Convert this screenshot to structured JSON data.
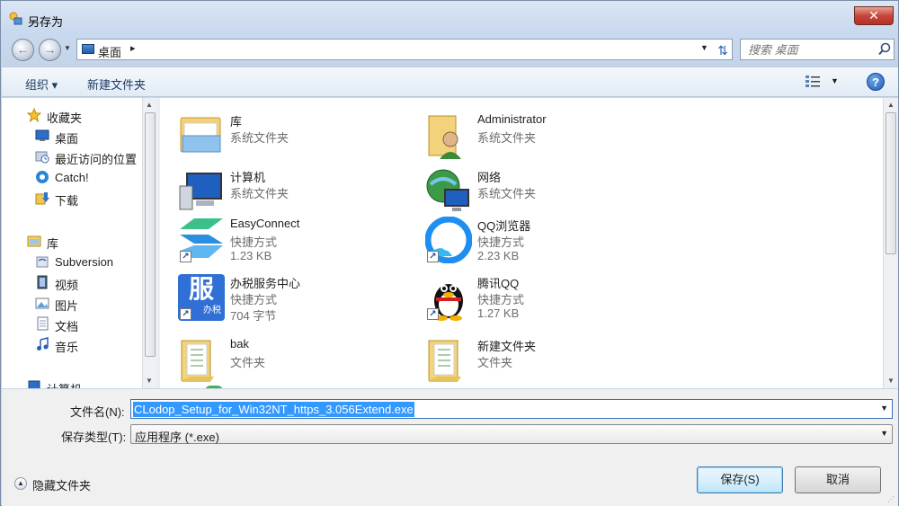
{
  "window": {
    "title": "另存为",
    "close_glyph": "✕"
  },
  "address": {
    "back_glyph": "←",
    "forward_glyph": "→",
    "path": "桌面",
    "separator": "▸",
    "refresh_glyph": "⇅",
    "search_placeholder": "搜索 桌面"
  },
  "toolbar": {
    "organize_label": "组织 ▾",
    "new_folder_label": "新建文件夹",
    "help_glyph": "?"
  },
  "nav": {
    "items": [
      {
        "label": "收藏夹",
        "icon": "star-icon"
      },
      {
        "label": "桌面",
        "icon": "desktop-icon"
      },
      {
        "label": "最近访问的位置",
        "icon": "recent-places-icon"
      },
      {
        "label": "Catch!",
        "icon": "catch-icon"
      },
      {
        "label": "下载",
        "icon": "downloads-icon"
      },
      {
        "label": "库",
        "icon": "library-icon"
      },
      {
        "label": "Subversion",
        "icon": "subversion-icon"
      },
      {
        "label": "视频",
        "icon": "videos-icon"
      },
      {
        "label": "图片",
        "icon": "pictures-icon"
      },
      {
        "label": "文档",
        "icon": "documents-icon"
      },
      {
        "label": "音乐",
        "icon": "music-icon"
      },
      {
        "label": "计算机",
        "icon": "computer-icon"
      }
    ]
  },
  "content": {
    "items": [
      {
        "name": "库",
        "sub1": "系统文件夹",
        "sub2": "",
        "icon": "library-folder-icon"
      },
      {
        "name": "Administrator",
        "sub1": "系统文件夹",
        "sub2": "",
        "icon": "user-folder-icon"
      },
      {
        "name": "计算机",
        "sub1": "系统文件夹",
        "sub2": "",
        "icon": "computer-icon"
      },
      {
        "name": "网络",
        "sub1": "系统文件夹",
        "sub2": "",
        "icon": "network-icon"
      },
      {
        "name": "EasyConnect",
        "sub1": "快捷方式",
        "sub2": "1.23 KB",
        "icon": "easyconnect-icon"
      },
      {
        "name": "QQ浏览器",
        "sub1": "快捷方式",
        "sub2": "2.23 KB",
        "icon": "qq-browser-icon"
      },
      {
        "name": "办税服务中心",
        "sub1": "快捷方式",
        "sub2": "704 字节",
        "icon": "tax-service-icon"
      },
      {
        "name": "腾讯QQ",
        "sub1": "快捷方式",
        "sub2": "1.27 KB",
        "icon": "qq-penguin-icon"
      },
      {
        "name": "bak",
        "sub1": "文件夹",
        "sub2": "",
        "icon": "folder-icon"
      },
      {
        "name": "新建文件夹",
        "sub1": "文件夹",
        "sub2": "",
        "icon": "folder-icon"
      }
    ],
    "tax_icon_glyph": "服",
    "tax_icon_caption": "办税",
    "shortcut_glyph": "↗"
  },
  "form": {
    "filename_label": "文件名(N):",
    "filename_value": "CLodop_Setup_for_Win32NT_https_3.056Extend.exe",
    "type_label": "保存类型(T):",
    "type_value": "应用程序 (*.exe)",
    "dropdown_glyph": "▼",
    "hide_folders_label": "隐藏文件夹",
    "save_label": "保存(S)",
    "cancel_label": "取消"
  },
  "colors": {
    "selection": "#3399ff",
    "accent": "#2c63b4"
  }
}
